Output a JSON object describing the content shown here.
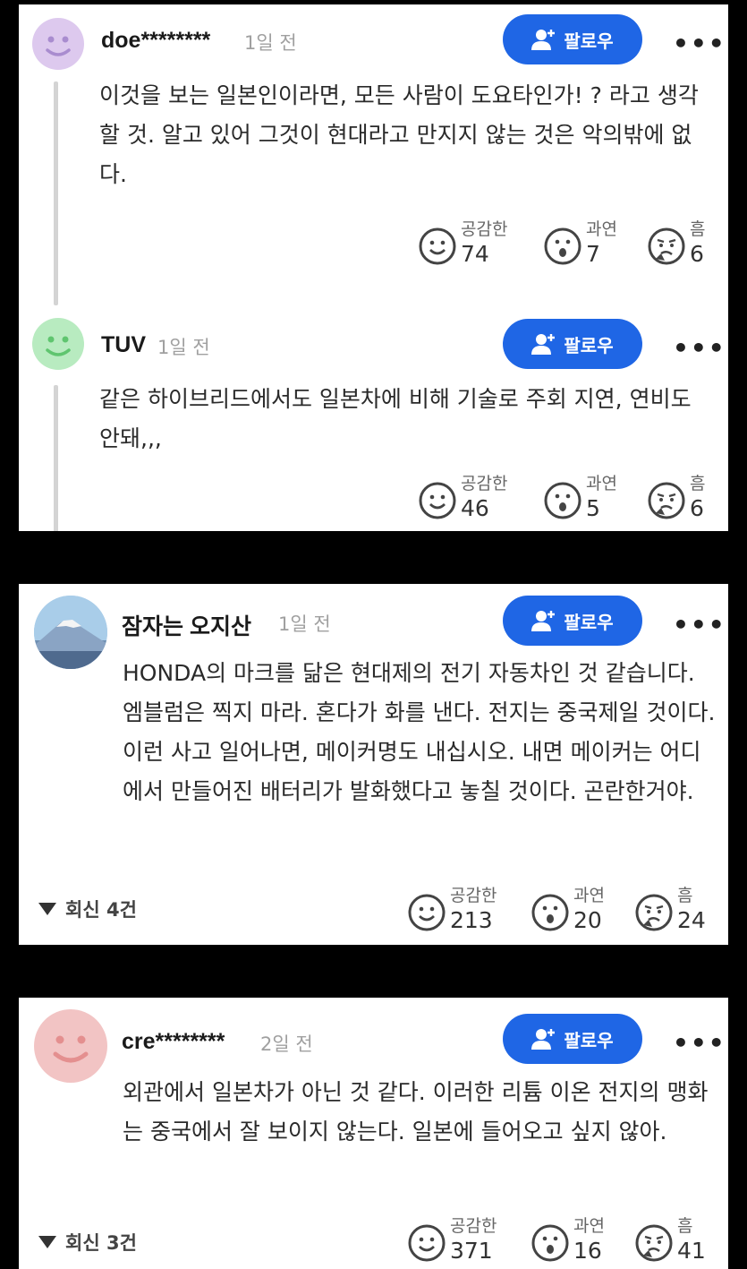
{
  "follow_label": "팔로우",
  "more_label": "•••",
  "colors": {
    "follow_bg": "#1f66e5",
    "avatar_purple": "#ddc9ee",
    "avatar_green": "#b8ebc0",
    "avatar_pink": "#f2c4c4"
  },
  "icons": {
    "follow": "add-person-icon",
    "empathy": "smile-face-icon",
    "surprise": "surprised-face-icon",
    "hmm": "thinking-face-icon"
  },
  "reaction_labels": {
    "empathy": "공감한",
    "surprise": "과연",
    "hmm": "흠"
  },
  "cards": [
    {
      "comments": [
        {
          "username": "doe********",
          "time": "1일 전",
          "text": "이것을 보는 일본인이라면, 모든 사람이 도요타인가! ? 라고 생각할 것. 알고 있어 그것이 현대라고 만지지 않는 것은 악의밖에 없다.",
          "reactions": {
            "empathy": "74",
            "surprise": "7",
            "hmm": "6"
          }
        },
        {
          "username": "TUV",
          "time": "1일 전",
          "text": "같은 하이브리드에서도 일본차에 비해 기술로 주회 지연, 연비도 안돼,,,",
          "reactions": {
            "empathy": "46",
            "surprise": "5",
            "hmm": "6"
          }
        }
      ]
    },
    {
      "comments": [
        {
          "username": "잠자는 오지산",
          "time": "1일 전",
          "text": "HONDA의 마크를 닮은 현대제의 전기 자동차인 것 같습니다. 엠블럼은 찍지 마라. 혼다가 화를 낸다. 전지는 중국제일 것이다. 이런 사고 일어나면, 메이커명도 내십시오. 내면 메이커는 어디에서 만들어진 배터리가 발화했다고 놓칠 것이다. 곤란한거야.",
          "replies": "회신 4건",
          "reactions": {
            "empathy": "213",
            "surprise": "20",
            "hmm": "24"
          }
        }
      ]
    },
    {
      "comments": [
        {
          "username": "cre********",
          "time": "2일 전",
          "text": "외관에서 일본차가 아닌 것 같다. 이러한 리튬 이온 전지의 맹화는 중국에서 잘 보이지 않는다. 일본에 들어오고 싶지 않아.",
          "replies": "회신 3건",
          "reactions": {
            "empathy": "371",
            "surprise": "16",
            "hmm": "41"
          }
        }
      ]
    }
  ]
}
